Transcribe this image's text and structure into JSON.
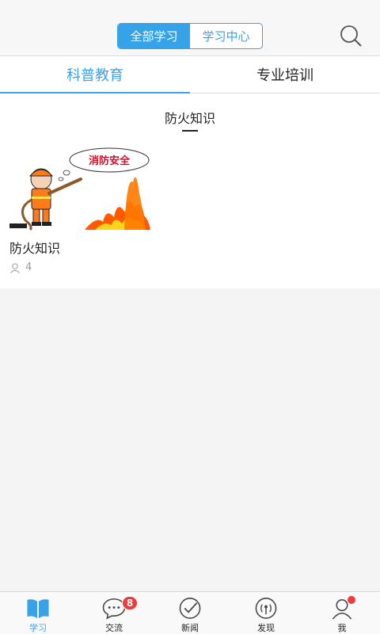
{
  "header": {
    "segments": [
      "全部学习",
      "学习中心"
    ],
    "search_icon": "search-icon"
  },
  "tabs": [
    {
      "label": "科普教育"
    },
    {
      "label": "专业培训"
    }
  ],
  "section": {
    "title": "防火知识"
  },
  "course": {
    "banner_text": "消防安全",
    "title": "防火知识",
    "learners": "4"
  },
  "bottom_nav": {
    "items": [
      {
        "label": "学习",
        "icon": "book-icon"
      },
      {
        "label": "交流",
        "icon": "chat-icon"
      },
      {
        "label": "新闻",
        "icon": "check-circle-icon"
      },
      {
        "label": "发现",
        "icon": "broadcast-icon"
      },
      {
        "label": "我",
        "icon": "user-icon"
      }
    ],
    "chat_badge": "8"
  },
  "colors": {
    "accent": "#36a3e8",
    "badge": "#ee3b3b"
  }
}
